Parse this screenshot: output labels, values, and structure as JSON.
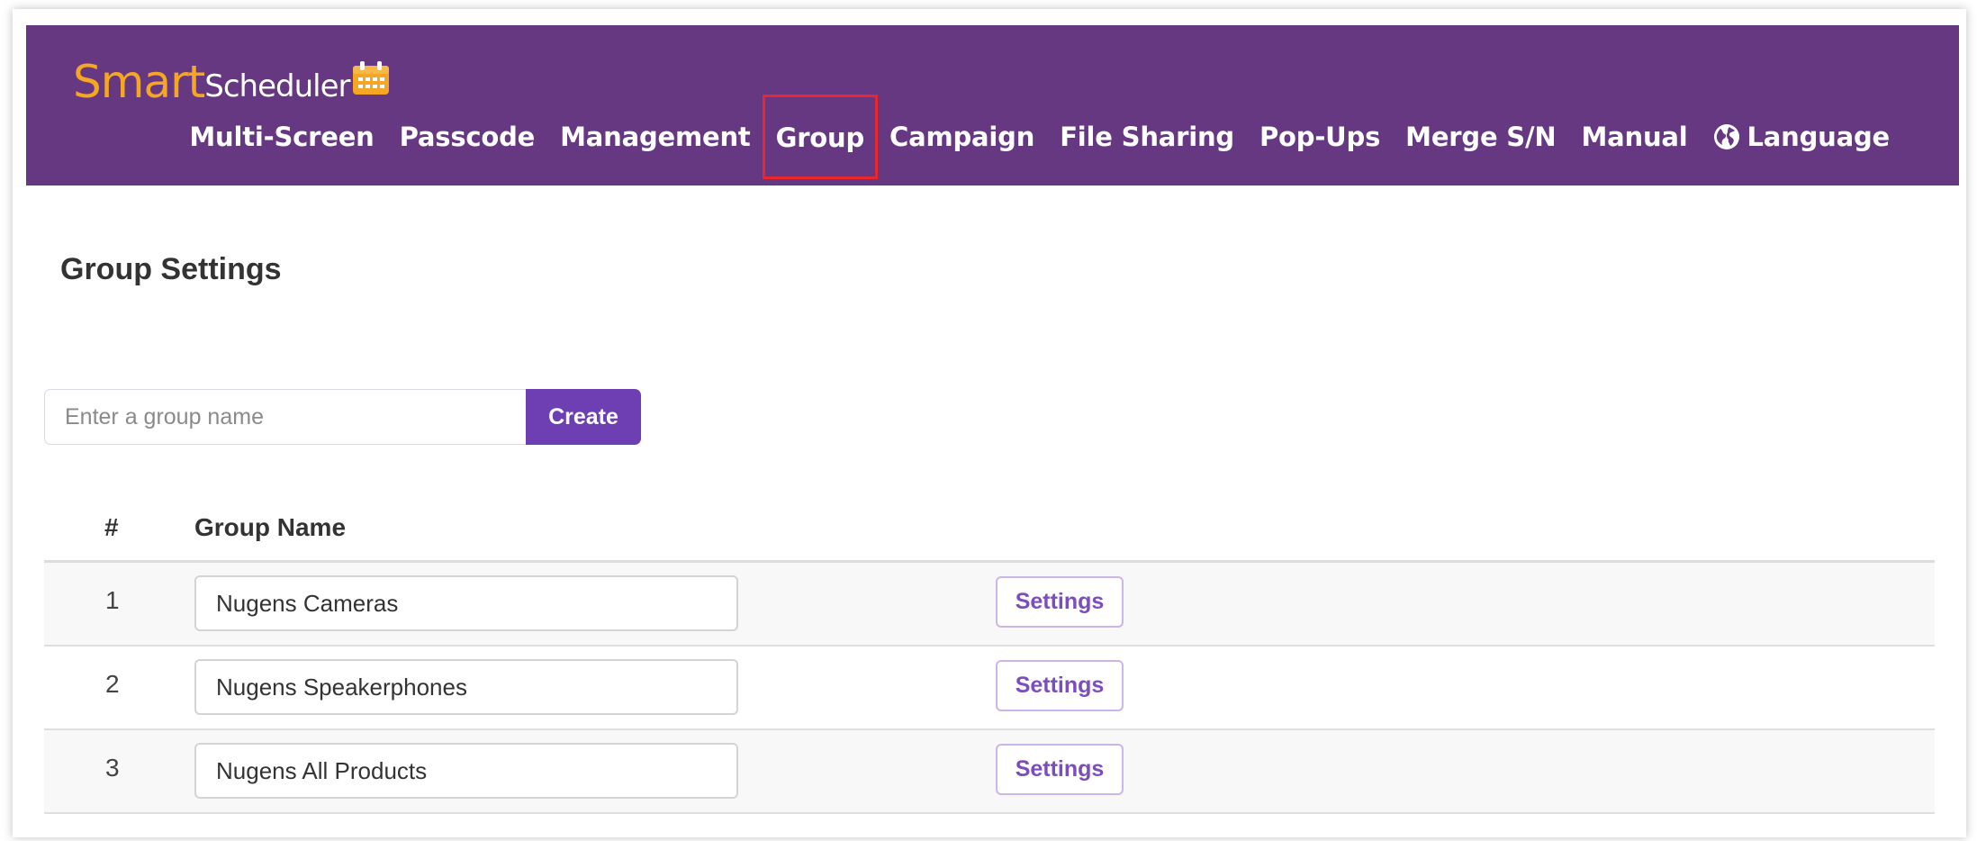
{
  "app": {
    "logo_smart": "Smart",
    "logo_scheduler": "Scheduler"
  },
  "nav": {
    "items": [
      {
        "label": "Multi-Screen"
      },
      {
        "label": "Passcode"
      },
      {
        "label": "Management"
      },
      {
        "label": "Group",
        "highlighted": true
      },
      {
        "label": "Campaign"
      },
      {
        "label": "File Sharing"
      },
      {
        "label": "Pop-Ups"
      },
      {
        "label": "Merge S/N"
      },
      {
        "label": "Manual"
      },
      {
        "label": "Language",
        "icon": "globe-icon"
      }
    ]
  },
  "page": {
    "title": "Group Settings"
  },
  "create": {
    "placeholder": "Enter a group name",
    "value": "",
    "button_label": "Create"
  },
  "table": {
    "headers": [
      "#",
      "Group Name"
    ],
    "rows": [
      {
        "num": "1",
        "name": "Nugens Cameras",
        "action": "Settings"
      },
      {
        "num": "2",
        "name": "Nugens Speakerphones",
        "action": "Settings"
      },
      {
        "num": "3",
        "name": "Nugens All Products",
        "action": "Settings"
      }
    ]
  },
  "colors": {
    "navbar": "#663882",
    "accent": "#6e3fb3",
    "logo": "#f5a623",
    "highlight": "#e8262b"
  }
}
